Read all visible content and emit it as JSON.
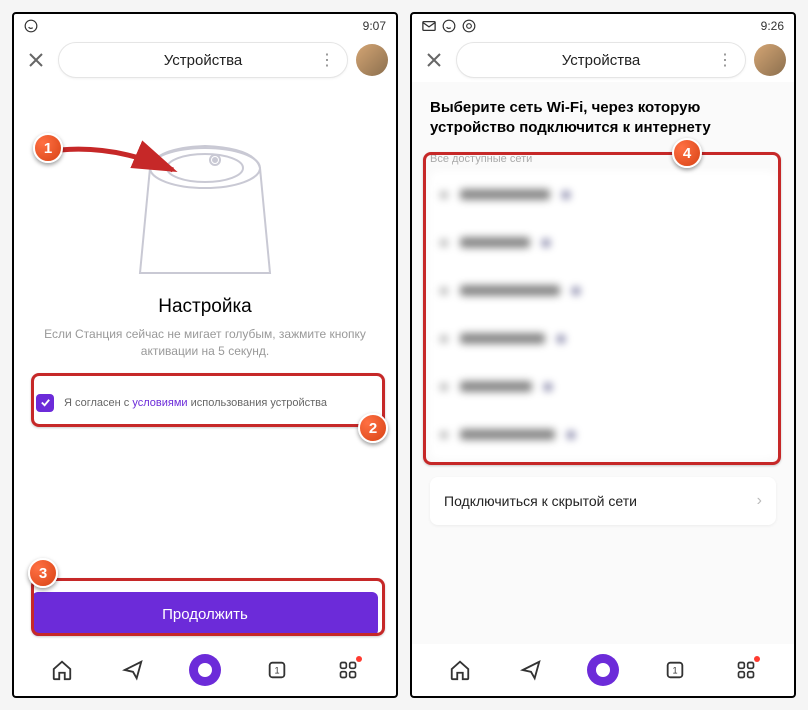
{
  "left": {
    "statusbar": {
      "time": "9:07"
    },
    "header": {
      "title": "Устройства"
    },
    "setup": {
      "title": "Настройка",
      "description": "Если Станция сейчас не мигает голубым, зажмите кнопку активации на 5 секунд."
    },
    "terms": {
      "prefix": "Я согласен с ",
      "link": "условиями",
      "suffix": " использования устройства"
    },
    "cta": "Продолжить"
  },
  "right": {
    "statusbar": {
      "time": "9:26"
    },
    "header": {
      "title": "Устройства"
    },
    "wifi": {
      "heading": "Выберите сеть Wi-Fi, через которую устройство подключится к интернету",
      "all_networks_label": "Все доступные сети",
      "hidden_network": "Подключиться к скрытой сети",
      "networks_widths": [
        90,
        70,
        100,
        85,
        72,
        95
      ]
    }
  },
  "annotations": {
    "badges": {
      "b1": "1",
      "b2": "2",
      "b3": "3",
      "b4": "4"
    }
  }
}
